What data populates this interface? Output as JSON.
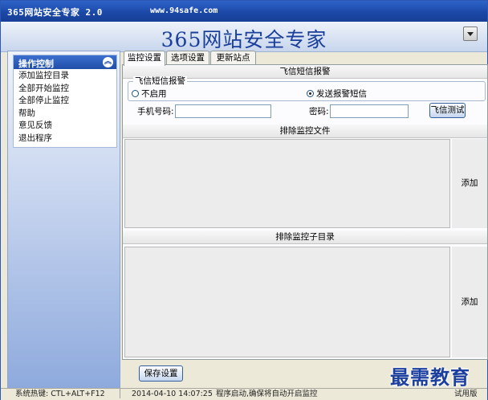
{
  "window": {
    "title": "365网站安全专家 2.0",
    "url": "www.94safe.com"
  },
  "banner": {
    "title": "365网站安全专家"
  },
  "sidebar": {
    "panel_title": "操作控制",
    "items": [
      {
        "label": "添加监控目录"
      },
      {
        "label": "全部开始监控"
      },
      {
        "label": "全部停止监控"
      },
      {
        "label": "帮助"
      },
      {
        "label": "意见反馈"
      },
      {
        "label": "退出程序"
      }
    ]
  },
  "tabs": [
    {
      "label": "监控设置",
      "active": true
    },
    {
      "label": "选项设置",
      "active": false
    },
    {
      "label": "更新站点",
      "active": false
    }
  ],
  "fetion": {
    "section_title": "飞信短信报警",
    "group_label": "飞信短信报警",
    "radio_disable": "不启用",
    "radio_send": "发送报警短信",
    "selected": "发送报警短信",
    "phone_label": "手机号码:",
    "phone_value": "",
    "password_label": "密码:",
    "password_value": "",
    "test_button": "飞信测试"
  },
  "exclude_files": {
    "title": "排除监控文件",
    "add_label": "添加"
  },
  "exclude_dirs": {
    "title": "排除监控子目录",
    "add_label": "添加"
  },
  "save_button": "保存设置",
  "statusbar": {
    "hotkey": "系统热键: CTL+ALT+F12",
    "timestamp": "2014-04-10 14:07:25",
    "message": "程序启动,确保将自动开启监控",
    "edition": "试用版"
  },
  "watermark": "最需教育",
  "colors": {
    "accent": "#204ea9",
    "banner_text": "#1a3f9a"
  }
}
